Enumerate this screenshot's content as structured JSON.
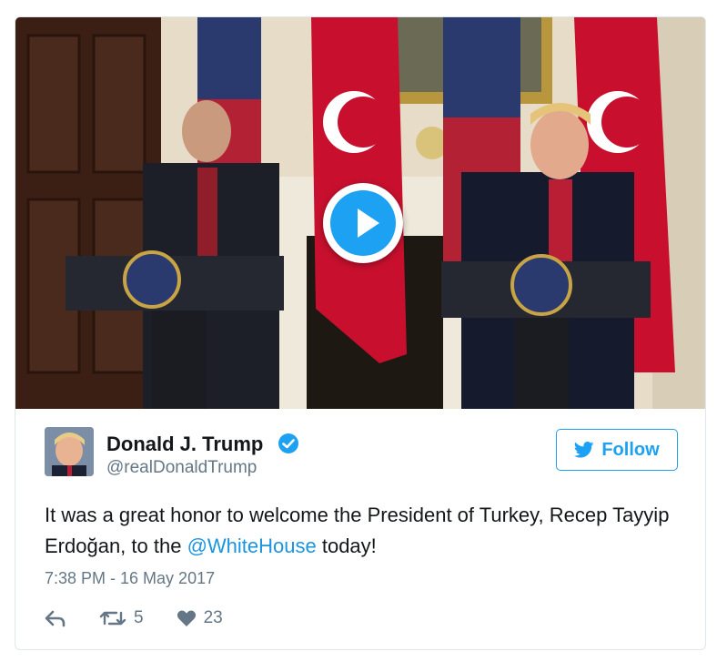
{
  "tweet": {
    "author_name": "Donald J. Trump",
    "author_handle": "@realDonaldTrump",
    "follow_label": "Follow",
    "text_before": "It was a great honor to welcome the President of Turkey, Recep Tayyip Erdoğan, to the ",
    "mention": "@WhiteHouse",
    "text_after": " today!",
    "timestamp": "7:38 PM - 16 May 2017",
    "retweets": "5",
    "likes": "23"
  },
  "icons": {
    "verified": "verified-badge-icon",
    "twitter_bird": "twitter-bird-icon",
    "reply": "reply-icon",
    "retweet": "retweet-icon",
    "like": "heart-icon",
    "play": "play-icon"
  },
  "colors": {
    "accent": "#1da1f2",
    "text": "#14171a",
    "muted": "#657786",
    "mention": "#1b95e0"
  }
}
